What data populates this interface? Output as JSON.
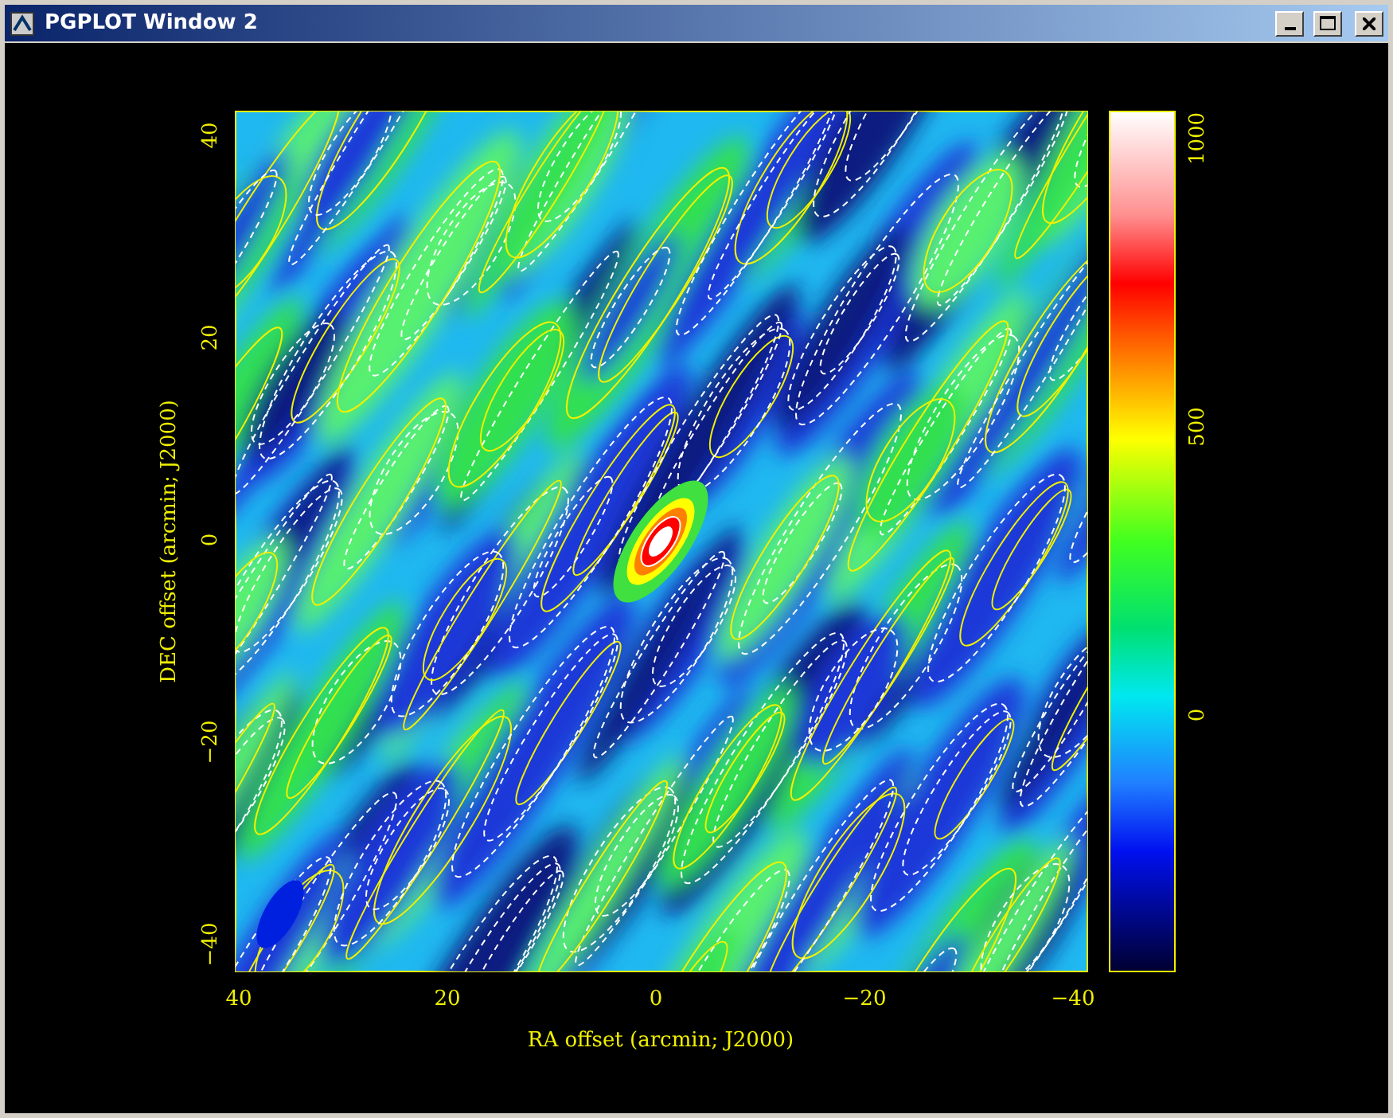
{
  "window": {
    "title": "PGPLOT Window 2"
  },
  "plot": {
    "xlabel": "RA offset (arcmin; J2000)",
    "ylabel": "DEC offset (arcmin; J2000)",
    "xticks": [
      "40",
      "20",
      "0",
      "−20",
      "−40"
    ],
    "yticks": [
      "40",
      "20",
      "0",
      "−20",
      "−40"
    ],
    "colorbar_ticks": [
      "1000",
      "500",
      "0"
    ]
  }
}
